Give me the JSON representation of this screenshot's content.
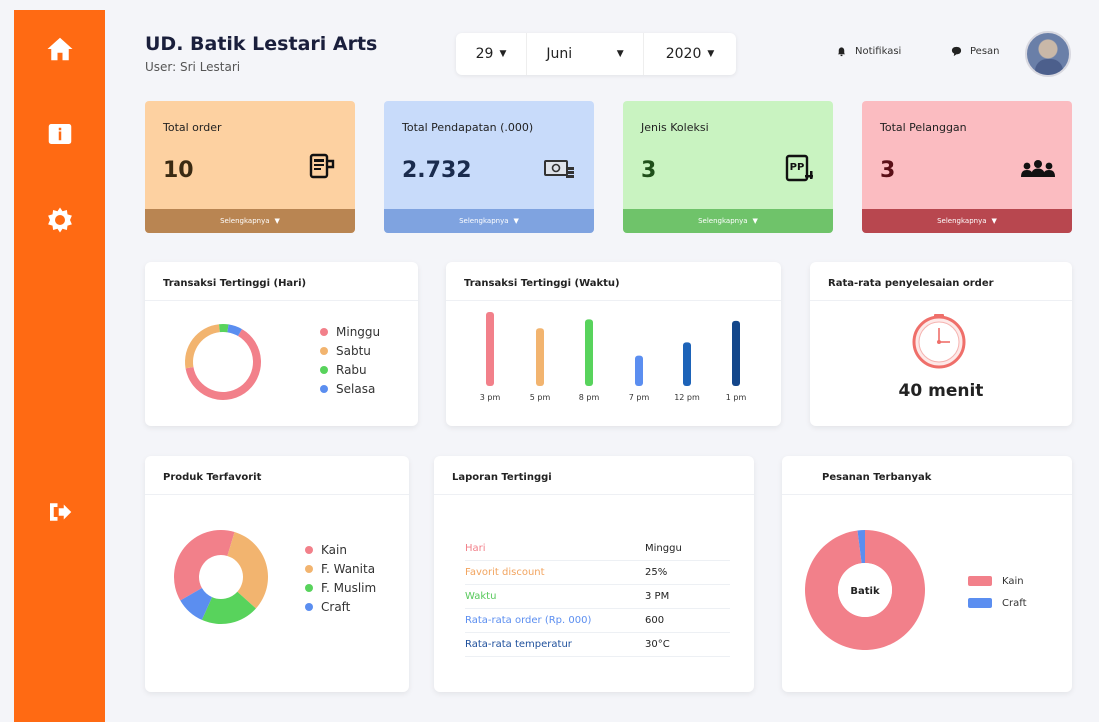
{
  "header": {
    "title": "UD. Batik Lestari Arts",
    "user": "User: Sri Lestari",
    "date": {
      "day": "29",
      "month": "Juni",
      "year": "2020"
    },
    "notification_label": "Notifikasi",
    "message_label": "Pesan"
  },
  "sidebar": {
    "items": [
      {
        "icon": "home-icon"
      },
      {
        "icon": "info-icon"
      },
      {
        "icon": "gear-icon"
      },
      {
        "icon": "logout-icon"
      }
    ]
  },
  "cards": [
    {
      "title": "Total order",
      "value": "10",
      "footer": "Selengkapnya",
      "bg": "#fdd1a1",
      "foot_bg": "#b98552",
      "value_color": "#3a2a12",
      "icon": "receipt-icon"
    },
    {
      "title": "Total Pendapatan (.000)",
      "value": "2.732",
      "footer": "Selengkapnya",
      "bg": "#c8dbfa",
      "foot_bg": "#7fa3e0",
      "value_color": "#1a2b4d",
      "icon": "money-icon"
    },
    {
      "title": "Jenis Koleksi",
      "value": "3",
      "footer": "Selengkapnya",
      "bg": "#c9f3c1",
      "foot_bg": "#6fc36a",
      "value_color": "#1f4f1a",
      "icon": "collection-icon"
    },
    {
      "title": "Total Pelanggan",
      "value": "3",
      "footer": "Selengkapnya",
      "bg": "#fbbcc1",
      "foot_bg": "#b8474f",
      "value_color": "#5a0f17",
      "icon": "customers-icon"
    }
  ],
  "panels": {
    "transaksi_hari": {
      "title": "Transaksi Tertinggi (Hari)",
      "legend": [
        "Minggu",
        "Sabtu",
        "Rabu",
        "Selasa"
      ],
      "colors": [
        "#f2808a",
        "#f2b46f",
        "#58d35c",
        "#5b8ef0"
      ],
      "values": [
        64,
        26,
        4,
        6
      ]
    },
    "transaksi_waktu": {
      "title": "Transaksi Tertinggi (Waktu)",
      "categories": [
        "3 pm",
        "5 pm",
        "8 pm",
        "7 pm",
        "12 pm",
        "1 pm"
      ],
      "values": [
        10,
        7.8,
        9,
        4.1,
        5.9,
        8.8
      ],
      "colors": [
        "#f2808a",
        "#f2b46f",
        "#58d35c",
        "#5b8ef0",
        "#1d63b8",
        "#13468a"
      ]
    },
    "rata_order": {
      "title": "Rata-rata penyelesaian order",
      "value": "40 menit"
    },
    "produk_favorit": {
      "title": "Produk Terfavorit",
      "legend": [
        "Kain",
        "F. Wanita",
        "F. Muslim",
        "Craft"
      ],
      "colors": [
        "#f2808a",
        "#f2b46f",
        "#58d35c",
        "#5b8ef0"
      ],
      "values": [
        38,
        32,
        20,
        10
      ]
    },
    "laporan": {
      "title": "Laporan Tertinggi",
      "rows": [
        {
          "key": "Hari",
          "value": "Minggu",
          "color": "#f2808a"
        },
        {
          "key": "Favorit discount",
          "value": "25%",
          "color": "#f2a45f"
        },
        {
          "key": "Waktu",
          "value": "3 PM",
          "color": "#58c95c"
        },
        {
          "key": "Rata-rata order (Rp. 000)",
          "value": "600",
          "color": "#5b8ef0"
        },
        {
          "key": "Rata-rata temperatur",
          "value": "30°C",
          "color": "#1d4f9c"
        }
      ]
    },
    "pesanan": {
      "title": "Pesanan Terbanyak",
      "center_label": "Batik",
      "legend": [
        "Kain",
        "Craft"
      ],
      "colors": [
        "#f2808a",
        "#5b8ef0"
      ],
      "values": [
        98,
        2
      ]
    }
  }
}
